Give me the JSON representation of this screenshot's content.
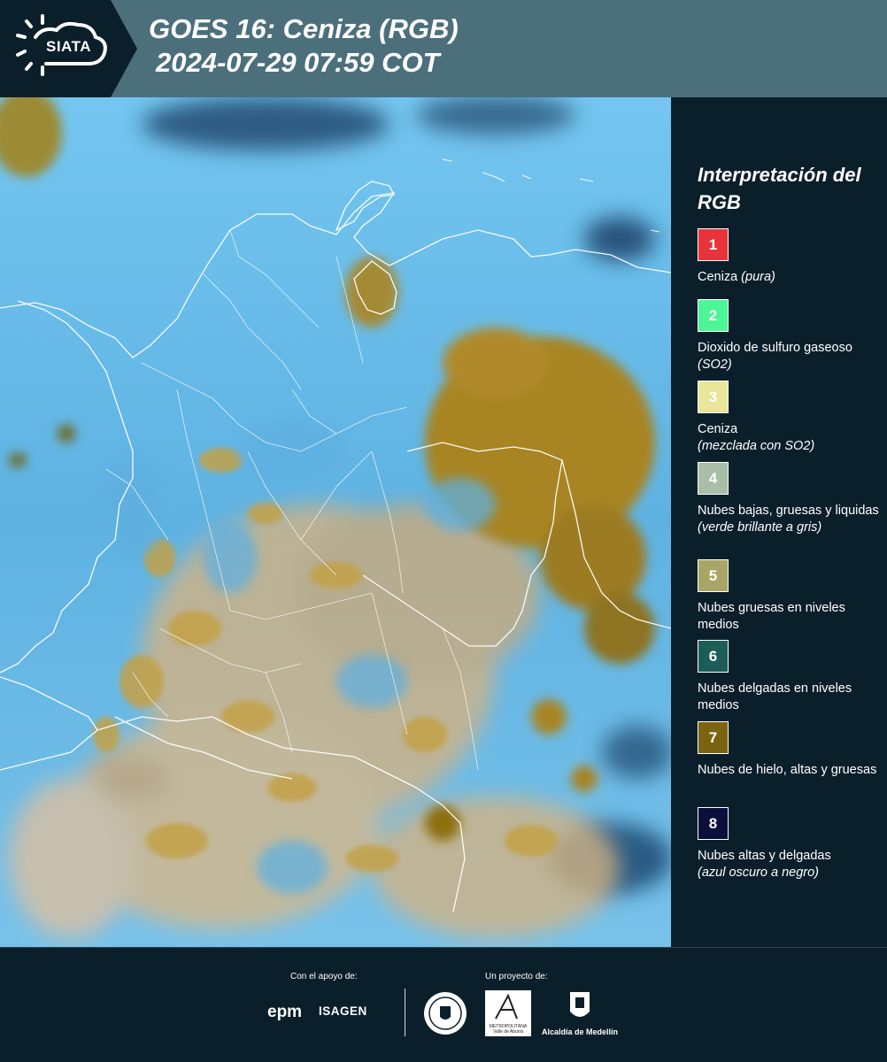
{
  "header": {
    "logo_text": "SIATA",
    "title": "GOES 16: Ceniza (RGB)",
    "datetime": "2024-07-29 07:59 COT"
  },
  "legend": {
    "title": "Interpretación del RGB",
    "items": [
      {
        "number": "1",
        "label": "Ceniza",
        "note": "(pura)",
        "color": "#e8333b",
        "text_color": "#ffffff"
      },
      {
        "number": "2",
        "label": "Dioxido de sulfuro gaseoso",
        "note": "(SO2)",
        "color": "#4cf595",
        "text_color": "#ffffff"
      },
      {
        "number": "3",
        "label": "Ceniza",
        "note": "(mezclada con SO2)",
        "color": "#e9e59a",
        "text_color": "#ffffff"
      },
      {
        "number": "4",
        "label": "Nubes bajas, gruesas y liquidas",
        "note": "(verde brillante a gris)",
        "color": "#a9bea6",
        "text_color": "#ffffff"
      },
      {
        "number": "5",
        "label": "Nubes gruesas en niveles medios",
        "note": "",
        "color": "#a9a566",
        "text_color": "#ffffff"
      },
      {
        "number": "6",
        "label": "Nubes delgadas en niveles medios",
        "note": "",
        "color": "#1d5d58",
        "text_color": "#ffffff"
      },
      {
        "number": "7",
        "label": "Nubes de hielo, altas y gruesas",
        "note": "",
        "color": "#7b6410",
        "text_color": "#ffffff"
      },
      {
        "number": "8",
        "label": "Nubes altas y delgadas",
        "note": "(azul oscuro a negro)",
        "color": "#0b0f3c",
        "text_color": "#ffffff"
      }
    ]
  },
  "footer": {
    "support_label": "Con el apoyo de:",
    "project_label": "Un proyecto de:",
    "epm": "epm",
    "isagen": "ISAGEN",
    "area_metropolitana": "METROPOLITANA Valle de Aburrá",
    "alcaldia": "Alcaldía de Medellín"
  },
  "colors": {
    "header_bg": "#4c6f7c",
    "page_bg": "#0b1f2b",
    "map_sky": "#5eb0e0",
    "map_cloud_ice": "#a8862a",
    "map_land_clear": "#d2b07c"
  }
}
